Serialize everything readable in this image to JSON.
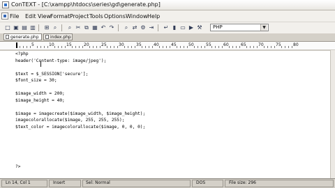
{
  "window": {
    "title": "ConTEXT - [C:\\xampp\\htdocs\\series\\gd\\generate.php]"
  },
  "menu": {
    "items": [
      "File",
      "Edit",
      "View",
      "Format",
      "Project",
      "Tools",
      "Options",
      "Window",
      "Help"
    ]
  },
  "toolbar": {
    "highlighter": "PHP"
  },
  "tabs": [
    "generate.php",
    "index.php"
  ],
  "ruler": {
    "labels": [
      "5",
      "10",
      "15",
      "20",
      "25",
      "30",
      "35",
      "40",
      "45",
      "50",
      "55",
      "60",
      "65",
      "70",
      "75",
      "80"
    ]
  },
  "code": [
    "<?php",
    "header('Content-type: image/jpeg');",
    "",
    "$text = $_SESSION['secure'];",
    "$font_size = 30;",
    "",
    "$image_width = 200;",
    "$image_height = 40;",
    "",
    "$image = imagecreate($image_width, $image_height);",
    "imagecolorallocate($image, 255, 255, 255);",
    "$text_color = imagecolorallocate($image, 0, 0, 0);",
    "",
    "",
    "",
    "",
    "",
    "?>"
  ],
  "statusbar": {
    "position": "Ln 14, Col 1",
    "mode": "Insert",
    "selection": "Sel: Normal",
    "format": "DOS",
    "file_size": "File size: 296"
  }
}
